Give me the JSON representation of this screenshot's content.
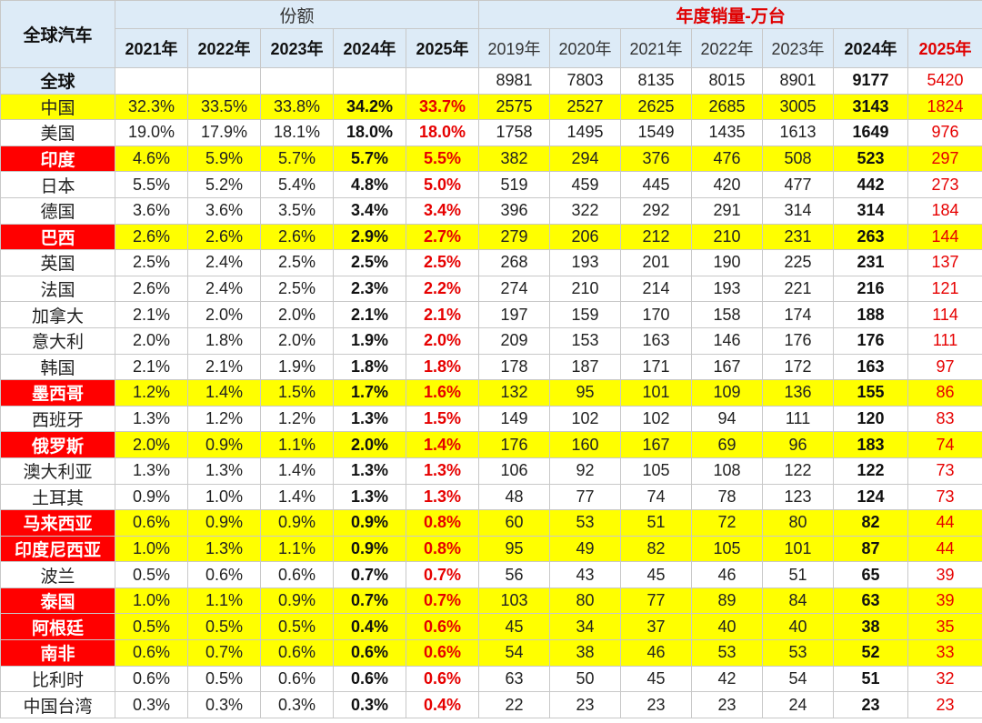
{
  "chart_data": {
    "type": "table",
    "corner_label": "全球汽车",
    "share_group_label": "份额",
    "sales_group_label": "年度销量-万台",
    "share_years": [
      "2021年",
      "2022年",
      "2023年",
      "2024年",
      "2025年"
    ],
    "sales_years": [
      "2019年",
      "2020年",
      "2021年",
      "2022年",
      "2023年",
      "2024年",
      "2025年"
    ],
    "colors": {
      "highlight_row": "#ffff00",
      "flag_cell": "#ff0000",
      "header_bg": "#ddebf7",
      "red_text": "#e60000"
    },
    "rows": [
      {
        "name": "全球",
        "global": true,
        "highlight": false,
        "flag": false,
        "share": [
          "",
          "",
          "",
          "",
          ""
        ],
        "sales": [
          "8981",
          "7803",
          "8135",
          "8015",
          "8901",
          "9177",
          "5420"
        ]
      },
      {
        "name": "中国",
        "highlight": true,
        "flag": false,
        "share": [
          "32.3%",
          "33.5%",
          "33.8%",
          "34.2%",
          "33.7%"
        ],
        "sales": [
          "2575",
          "2527",
          "2625",
          "2685",
          "3005",
          "3143",
          "1824"
        ]
      },
      {
        "name": "美国",
        "highlight": false,
        "flag": false,
        "share": [
          "19.0%",
          "17.9%",
          "18.1%",
          "18.0%",
          "18.0%"
        ],
        "sales": [
          "1758",
          "1495",
          "1549",
          "1435",
          "1613",
          "1649",
          "976"
        ]
      },
      {
        "name": "印度",
        "highlight": true,
        "flag": true,
        "share": [
          "4.6%",
          "5.9%",
          "5.7%",
          "5.7%",
          "5.5%"
        ],
        "sales": [
          "382",
          "294",
          "376",
          "476",
          "508",
          "523",
          "297"
        ]
      },
      {
        "name": "日本",
        "highlight": false,
        "flag": false,
        "share": [
          "5.5%",
          "5.2%",
          "5.4%",
          "4.8%",
          "5.0%"
        ],
        "sales": [
          "519",
          "459",
          "445",
          "420",
          "477",
          "442",
          "273"
        ]
      },
      {
        "name": "德国",
        "highlight": false,
        "flag": false,
        "share": [
          "3.6%",
          "3.6%",
          "3.5%",
          "3.4%",
          "3.4%"
        ],
        "sales": [
          "396",
          "322",
          "292",
          "291",
          "314",
          "314",
          "184"
        ]
      },
      {
        "name": "巴西",
        "highlight": true,
        "flag": true,
        "share": [
          "2.6%",
          "2.6%",
          "2.6%",
          "2.9%",
          "2.7%"
        ],
        "sales": [
          "279",
          "206",
          "212",
          "210",
          "231",
          "263",
          "144"
        ]
      },
      {
        "name": "英国",
        "highlight": false,
        "flag": false,
        "share": [
          "2.5%",
          "2.4%",
          "2.5%",
          "2.5%",
          "2.5%"
        ],
        "sales": [
          "268",
          "193",
          "201",
          "190",
          "225",
          "231",
          "137"
        ]
      },
      {
        "name": "法国",
        "highlight": false,
        "flag": false,
        "share": [
          "2.6%",
          "2.4%",
          "2.5%",
          "2.3%",
          "2.2%"
        ],
        "sales": [
          "274",
          "210",
          "214",
          "193",
          "221",
          "216",
          "121"
        ]
      },
      {
        "name": "加拿大",
        "highlight": false,
        "flag": false,
        "share": [
          "2.1%",
          "2.0%",
          "2.0%",
          "2.1%",
          "2.1%"
        ],
        "sales": [
          "197",
          "159",
          "170",
          "158",
          "174",
          "188",
          "114"
        ]
      },
      {
        "name": "意大利",
        "highlight": false,
        "flag": false,
        "share": [
          "2.0%",
          "1.8%",
          "2.0%",
          "1.9%",
          "2.0%"
        ],
        "sales": [
          "209",
          "153",
          "163",
          "146",
          "176",
          "176",
          "111"
        ]
      },
      {
        "name": "韩国",
        "highlight": false,
        "flag": false,
        "share": [
          "2.1%",
          "2.1%",
          "1.9%",
          "1.8%",
          "1.8%"
        ],
        "sales": [
          "178",
          "187",
          "171",
          "167",
          "172",
          "163",
          "97"
        ]
      },
      {
        "name": "墨西哥",
        "highlight": true,
        "flag": true,
        "share": [
          "1.2%",
          "1.4%",
          "1.5%",
          "1.7%",
          "1.6%"
        ],
        "sales": [
          "132",
          "95",
          "101",
          "109",
          "136",
          "155",
          "86"
        ]
      },
      {
        "name": "西班牙",
        "highlight": false,
        "flag": false,
        "share": [
          "1.3%",
          "1.2%",
          "1.2%",
          "1.3%",
          "1.5%"
        ],
        "sales": [
          "149",
          "102",
          "102",
          "94",
          "111",
          "120",
          "83"
        ]
      },
      {
        "name": "俄罗斯",
        "highlight": true,
        "flag": true,
        "share": [
          "2.0%",
          "0.9%",
          "1.1%",
          "2.0%",
          "1.4%"
        ],
        "sales": [
          "176",
          "160",
          "167",
          "69",
          "96",
          "183",
          "74"
        ]
      },
      {
        "name": "澳大利亚",
        "highlight": false,
        "flag": false,
        "share": [
          "1.3%",
          "1.3%",
          "1.4%",
          "1.3%",
          "1.3%"
        ],
        "sales": [
          "106",
          "92",
          "105",
          "108",
          "122",
          "122",
          "73"
        ]
      },
      {
        "name": "土耳其",
        "highlight": false,
        "flag": false,
        "share": [
          "0.9%",
          "1.0%",
          "1.4%",
          "1.3%",
          "1.3%"
        ],
        "sales": [
          "48",
          "77",
          "74",
          "78",
          "123",
          "124",
          "73"
        ]
      },
      {
        "name": "马来西亚",
        "highlight": true,
        "flag": true,
        "share": [
          "0.6%",
          "0.9%",
          "0.9%",
          "0.9%",
          "0.8%"
        ],
        "sales": [
          "60",
          "53",
          "51",
          "72",
          "80",
          "82",
          "44"
        ]
      },
      {
        "name": "印度尼西亚",
        "highlight": true,
        "flag": true,
        "share": [
          "1.0%",
          "1.3%",
          "1.1%",
          "0.9%",
          "0.8%"
        ],
        "sales": [
          "95",
          "49",
          "82",
          "105",
          "101",
          "87",
          "44"
        ]
      },
      {
        "name": "波兰",
        "highlight": false,
        "flag": false,
        "share": [
          "0.5%",
          "0.6%",
          "0.6%",
          "0.7%",
          "0.7%"
        ],
        "sales": [
          "56",
          "43",
          "45",
          "46",
          "51",
          "65",
          "39"
        ]
      },
      {
        "name": "泰国",
        "highlight": true,
        "flag": true,
        "share": [
          "1.0%",
          "1.1%",
          "0.9%",
          "0.7%",
          "0.7%"
        ],
        "sales": [
          "103",
          "80",
          "77",
          "89",
          "84",
          "63",
          "39"
        ]
      },
      {
        "name": "阿根廷",
        "highlight": true,
        "flag": true,
        "share": [
          "0.5%",
          "0.5%",
          "0.5%",
          "0.4%",
          "0.6%"
        ],
        "sales": [
          "45",
          "34",
          "37",
          "40",
          "40",
          "38",
          "35"
        ]
      },
      {
        "name": "南非",
        "highlight": true,
        "flag": true,
        "share": [
          "0.6%",
          "0.7%",
          "0.6%",
          "0.6%",
          "0.6%"
        ],
        "sales": [
          "54",
          "38",
          "46",
          "53",
          "53",
          "52",
          "33"
        ]
      },
      {
        "name": "比利时",
        "highlight": false,
        "flag": false,
        "share": [
          "0.6%",
          "0.5%",
          "0.6%",
          "0.6%",
          "0.6%"
        ],
        "sales": [
          "63",
          "50",
          "45",
          "42",
          "54",
          "51",
          "32"
        ]
      },
      {
        "name": "中国台湾",
        "highlight": false,
        "flag": false,
        "share": [
          "0.3%",
          "0.3%",
          "0.3%",
          "0.3%",
          "0.4%"
        ],
        "sales": [
          "22",
          "23",
          "23",
          "23",
          "24",
          "23",
          "23"
        ]
      }
    ]
  }
}
